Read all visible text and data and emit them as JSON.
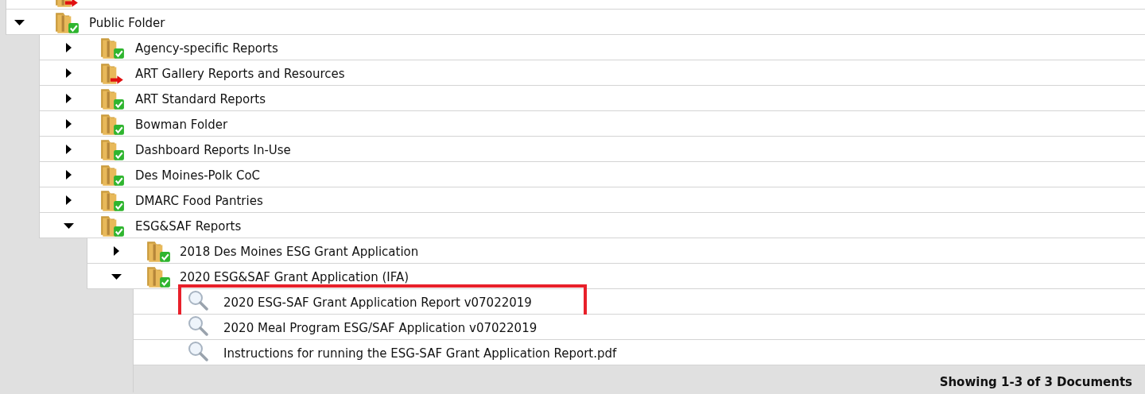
{
  "partial_row": {
    "kind": "folder",
    "linked": true
  },
  "tree": [
    {
      "label": "Public Folder",
      "kind": "folder",
      "linked": false,
      "expanded": true,
      "children": [
        {
          "label": "Agency-specific Reports",
          "kind": "folder",
          "linked": false,
          "expanded": false
        },
        {
          "label": "ART Gallery Reports and Resources",
          "kind": "folder",
          "linked": true,
          "expanded": false
        },
        {
          "label": "ART Standard Reports",
          "kind": "folder",
          "linked": false,
          "expanded": false
        },
        {
          "label": "Bowman Folder",
          "kind": "folder",
          "linked": false,
          "expanded": false
        },
        {
          "label": "Dashboard Reports In-Use",
          "kind": "folder",
          "linked": false,
          "expanded": false
        },
        {
          "label": "Des Moines-Polk CoC",
          "kind": "folder",
          "linked": false,
          "expanded": false
        },
        {
          "label": "DMARC Food Pantries",
          "kind": "folder",
          "linked": false,
          "expanded": false
        },
        {
          "label": "ESG&SAF Reports",
          "kind": "folder",
          "linked": false,
          "expanded": true,
          "children": [
            {
              "label": "2018 Des Moines ESG Grant Application",
              "kind": "folder",
              "linked": false,
              "expanded": false
            },
            {
              "label": "2020 ESG&SAF Grant Application (IFA)",
              "kind": "folder",
              "linked": false,
              "expanded": true,
              "children": [
                {
                  "label": "2020 ESG-SAF Grant Application Report v07022019",
                  "kind": "report",
                  "highlighted": true
                },
                {
                  "label": "2020 Meal Program ESG/SAF Application v07022019",
                  "kind": "report",
                  "highlighted": false
                },
                {
                  "label": "Instructions for running the ESG-SAF Grant Application Report.pdf",
                  "kind": "report",
                  "highlighted": false
                }
              ]
            }
          ]
        }
      ]
    }
  ],
  "status": "Showing 1-3 of 3 Documents"
}
